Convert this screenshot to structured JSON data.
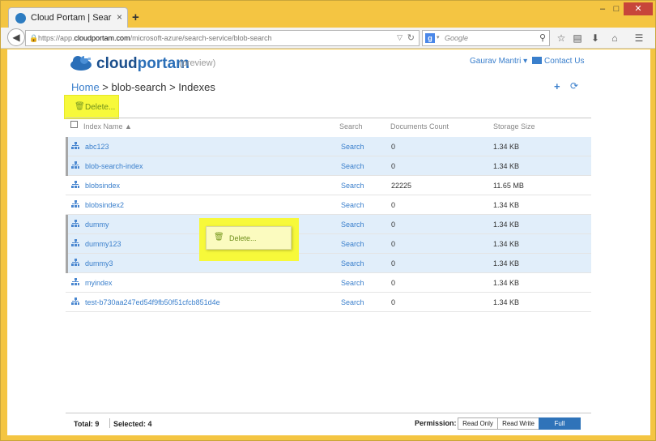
{
  "browser": {
    "tab_title": "Cloud Portam | Search Serv...",
    "tab_close": "×",
    "new_tab": "+",
    "url_prefix": "https://app.",
    "url_domain": "cloudportam.com",
    "url_path": "/microsoft-azure/search-service/blob-search",
    "search_placeholder": "Google",
    "window_min": "–",
    "window_max": "□",
    "window_close": "✕"
  },
  "header": {
    "brand_cloud": "cloud",
    "brand_portam": "portam",
    "preview": "(preview)",
    "user": "Gaurav Mantri ▾",
    "contact": "Contact Us"
  },
  "breadcrumb": {
    "home": "Home",
    "sep1": " > ",
    "service": "blob-search",
    "sep2": " > ",
    "current": "Indexes"
  },
  "toolbar": {
    "delete_label": "Delete..."
  },
  "table": {
    "headers": {
      "name": "Index Name ▲",
      "search": "Search",
      "count": "Documents Count",
      "size": "Storage Size"
    },
    "rows": [
      {
        "name": "abc123",
        "search": "Search",
        "count": "0",
        "size": "1.34 KB",
        "selected": true
      },
      {
        "name": "blob-search-index",
        "search": "Search",
        "count": "0",
        "size": "1.34 KB",
        "selected": true
      },
      {
        "name": "blobsindex",
        "search": "Search",
        "count": "22225",
        "size": "11.65 MB",
        "selected": false
      },
      {
        "name": "blobsindex2",
        "search": "Search",
        "count": "0",
        "size": "1.34 KB",
        "selected": false
      },
      {
        "name": "dummy",
        "search": "Search",
        "count": "0",
        "size": "1.34 KB",
        "selected": true
      },
      {
        "name": "dummy123",
        "search": "Search",
        "count": "0",
        "size": "1.34 KB",
        "selected": true
      },
      {
        "name": "dummy3",
        "search": "Search",
        "count": "0",
        "size": "1.34 KB",
        "selected": true
      },
      {
        "name": "myindex",
        "search": "Search",
        "count": "0",
        "size": "1.34 KB",
        "selected": false
      },
      {
        "name": "test-b730aa247ed54f9fb50f51cfcb851d4e",
        "search": "Search",
        "count": "0",
        "size": "1.34 KB",
        "selected": false
      }
    ]
  },
  "context_menu": {
    "delete_label": "Delete..."
  },
  "footer": {
    "total": "Total: 9",
    "selected": "Selected: 4",
    "permission_label": "Permission:",
    "read_only": "Read Only",
    "read_write": "Read Write",
    "full": "Full"
  },
  "colors": {
    "accent": "#3a7fcc",
    "selected_row": "#e1eefa",
    "highlight": "#f7f93a",
    "frame": "#f4c542"
  }
}
